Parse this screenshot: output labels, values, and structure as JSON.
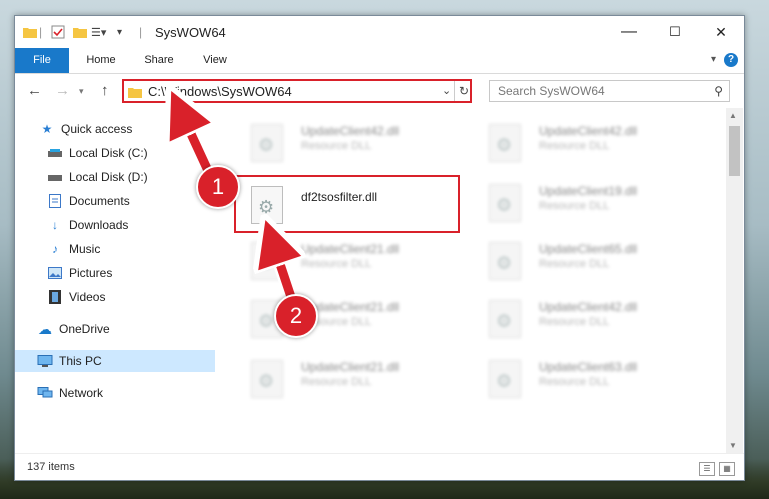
{
  "window": {
    "title": "SysWOW64",
    "controls": {
      "minimize": "—",
      "maximize": "☐",
      "close": "✕"
    }
  },
  "ribbon": {
    "tabs": [
      "File",
      "Home",
      "Share",
      "View"
    ],
    "help": "?"
  },
  "address": {
    "path": "C:\\Windows\\SysWOW64",
    "search_placeholder": "Search SysWOW64"
  },
  "sidebar": {
    "items": [
      {
        "label": "Quick access",
        "icon": "star-icon",
        "pinned": false
      },
      {
        "label": "Local Disk (C:)",
        "icon": "drive-icon",
        "pinned": true
      },
      {
        "label": "Local Disk (D:)",
        "icon": "drive-icon",
        "pinned": true
      },
      {
        "label": "Documents",
        "icon": "document-icon",
        "pinned": true
      },
      {
        "label": "Downloads",
        "icon": "download-icon",
        "pinned": true
      },
      {
        "label": "Music",
        "icon": "music-icon",
        "pinned": true
      },
      {
        "label": "Pictures",
        "icon": "picture-icon",
        "pinned": true
      },
      {
        "label": "Videos",
        "icon": "video-icon",
        "pinned": true
      },
      {
        "label": "OneDrive",
        "icon": "cloud-icon",
        "pinned": false
      },
      {
        "label": "This PC",
        "icon": "computer-icon",
        "pinned": false,
        "selected": true
      },
      {
        "label": "Network",
        "icon": "network-icon",
        "pinned": false
      }
    ]
  },
  "files": {
    "highlighted": {
      "name": "df2tsosfilter.dll"
    },
    "others": [
      {
        "name": "UpdateClient42.dll",
        "type": "Resource DLL"
      },
      {
        "name": "UpdateClient42.dll",
        "type": "Resource DLL"
      },
      {
        "name": "UpdateClient19.dll",
        "type": "Resource DLL"
      },
      {
        "name": "UpdateClient21.dll",
        "type": "Resource DLL"
      },
      {
        "name": "UpdateClient65.dll",
        "type": "Resource DLL"
      },
      {
        "name": "UpdateClient21.dll",
        "type": "Resource DLL"
      },
      {
        "name": "UpdateClient42.dll",
        "type": "Resource DLL"
      },
      {
        "name": "UpdateClient21.dll",
        "type": "Resource DLL"
      },
      {
        "name": "UpdateClient63.dll",
        "type": "Resource DLL"
      }
    ]
  },
  "status": {
    "count": "137 items"
  },
  "annotations": {
    "step1": "1",
    "step2": "2"
  },
  "colors": {
    "accent": "#1979ca",
    "highlight": "#d9212a",
    "selected": "#cde8ff"
  }
}
